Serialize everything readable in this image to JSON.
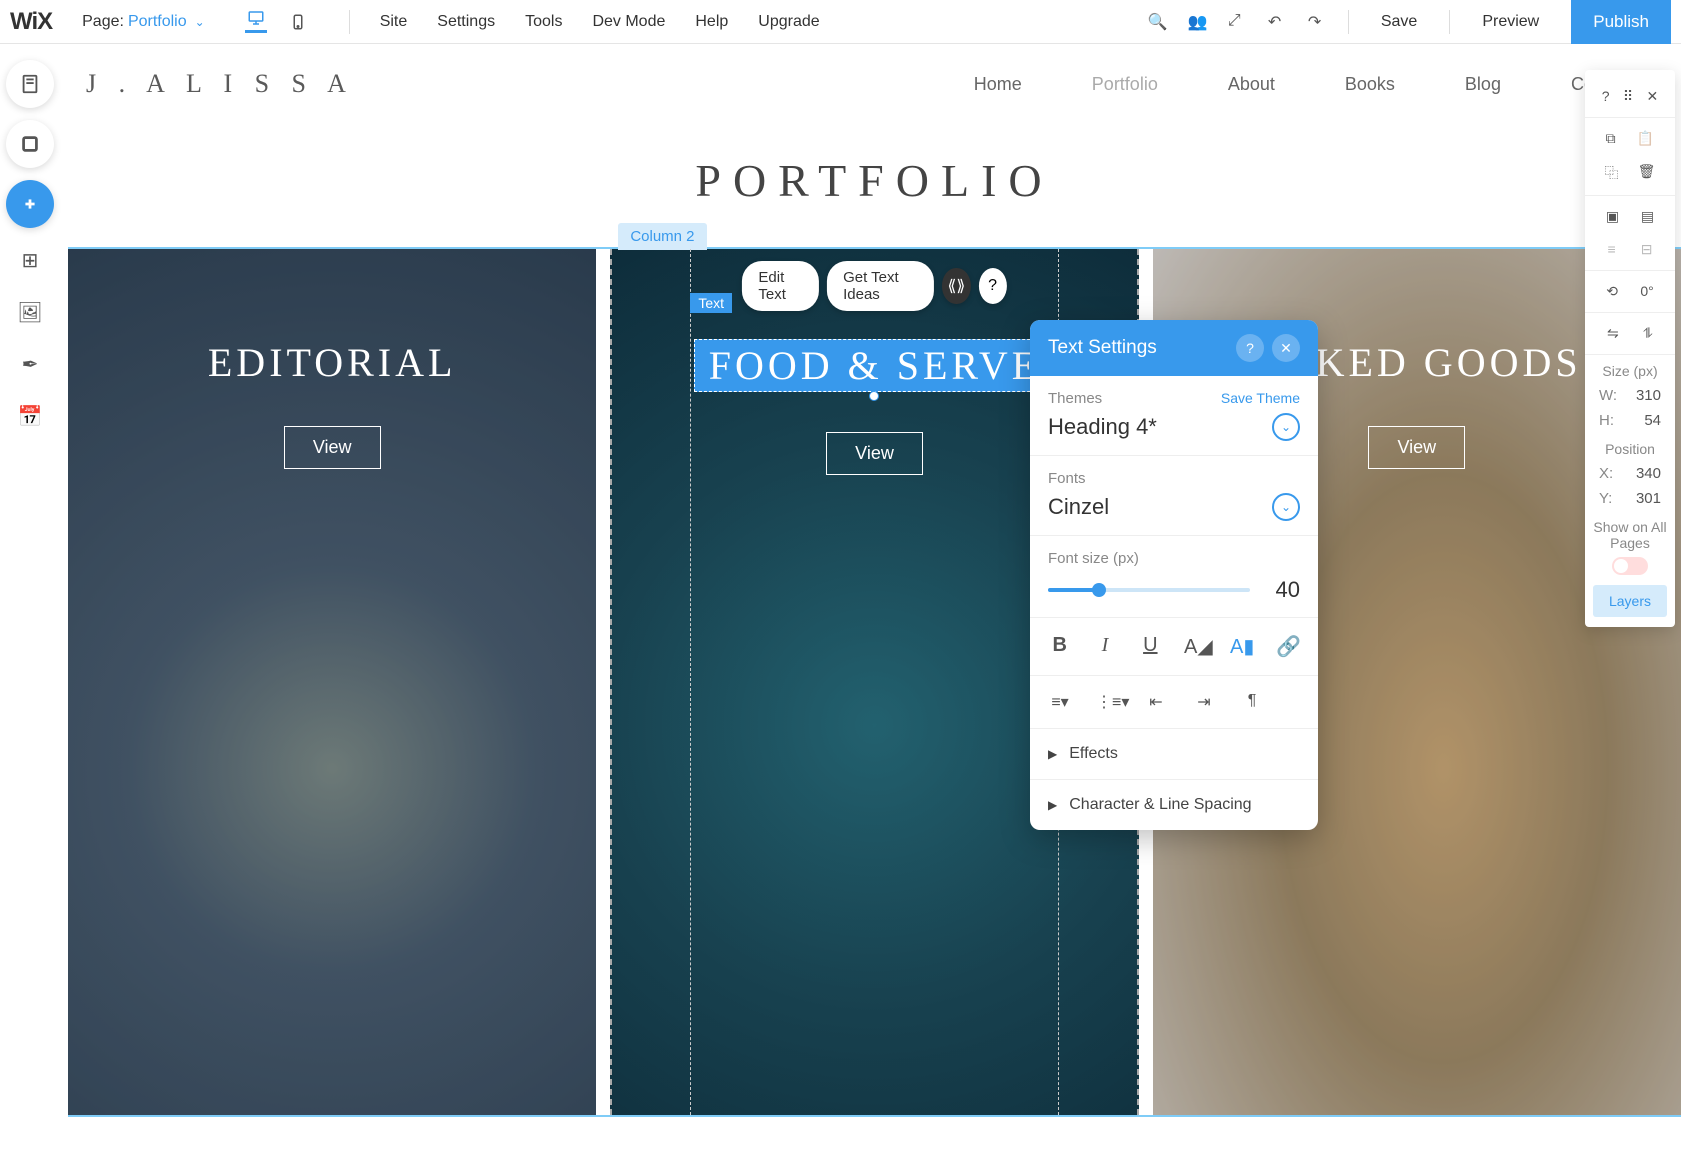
{
  "topbar": {
    "logo": "WiX",
    "page_label": "Page:",
    "page_name": "Portfolio",
    "menu": [
      "Site",
      "Settings",
      "Tools",
      "Dev Mode",
      "Help",
      "Upgrade"
    ],
    "save": "Save",
    "preview": "Preview",
    "publish": "Publish"
  },
  "site": {
    "logo": "J . A L I S S A",
    "nav": [
      "Home",
      "Portfolio",
      "About",
      "Books",
      "Blog",
      "Contact"
    ],
    "active_nav": "Portfolio",
    "page_title": "PORTFOLIO"
  },
  "columns": {
    "tag": "Column 2",
    "text_tag": "Text",
    "items": [
      {
        "title": "EDITORIAL",
        "button": "View"
      },
      {
        "title": "FOOD & SERVE",
        "button": "View"
      },
      {
        "title": "BAKED GOODS",
        "button": "View"
      }
    ],
    "actions": {
      "edit": "Edit Text",
      "ideas": "Get Text Ideas"
    }
  },
  "text_settings": {
    "title": "Text Settings",
    "themes_label": "Themes",
    "save_theme": "Save Theme",
    "theme_value": "Heading 4*",
    "fonts_label": "Fonts",
    "font_value": "Cinzel",
    "size_label": "Font size (px)",
    "size_value": "40",
    "effects": "Effects",
    "spacing": "Character & Line Spacing"
  },
  "inspector": {
    "rotation": "0°",
    "size_label": "Size (px)",
    "w_label": "W:",
    "w": "310",
    "h_label": "H:",
    "h": "54",
    "pos_label": "Position",
    "x_label": "X:",
    "x": "340",
    "y_label": "Y:",
    "y": "301",
    "show_label": "Show on All Pages",
    "layers": "Layers"
  }
}
